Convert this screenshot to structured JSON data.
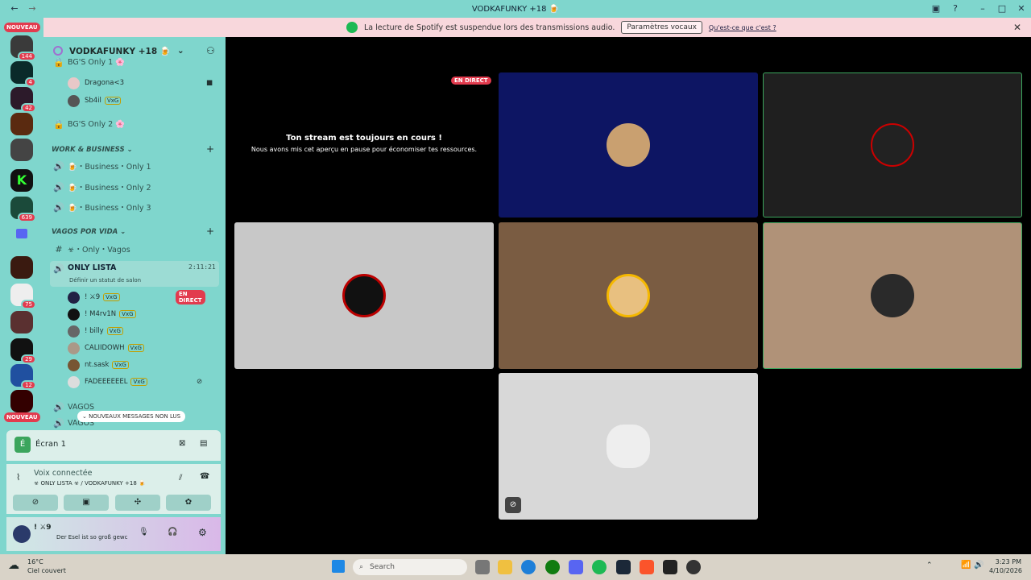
{
  "window": {
    "title": "VODKAFUNKY +18 🍺"
  },
  "banner": {
    "text": "La lecture de Spotify est suspendue lors des transmissions audio.",
    "button": "Paramètres vocaux",
    "link": "Qu'est-ce que c'est ?"
  },
  "rail": {
    "nouveau": "NOUVEAU",
    "badges": [
      "144",
      "4",
      "42",
      "639",
      "75",
      "29",
      "12"
    ]
  },
  "server": {
    "name": "VODKAFUNKY +18 🍺"
  },
  "channels": {
    "bg_only1": "BG'S Only 1 🌸",
    "bg_only2": "BG'S Only 2 🌸",
    "work_cat": "WORK & BUSINESS",
    "business": [
      "🍺・Business・Only 1",
      "🍺・Business・Only 2",
      "🍺・Business・Only 3"
    ],
    "vagos_cat": "VAGOS POR VIDA",
    "only_vagos": "☣・Only・Vagos",
    "only_lista": "ONLY LISTA",
    "only_lista_time": "2:11:21",
    "set_status": "Définir un statut de salon",
    "vagos1": "VAGOS",
    "vagos2": "VAGOS"
  },
  "users_top": [
    {
      "name": "Dragona<3",
      "tag": ""
    },
    {
      "name": "Sb4il",
      "tag": "VxG"
    }
  ],
  "users": [
    {
      "name": "! ⚔9",
      "tag": "VxG",
      "live": "EN DIRECT"
    },
    {
      "name": "! M4rv1N",
      "tag": "VxG",
      "live": ""
    },
    {
      "name": "! billy",
      "tag": "VxG",
      "live": ""
    },
    {
      "name": "CALIIDOWH",
      "tag": "VxG",
      "live": ""
    },
    {
      "name": "nt.sask",
      "tag": "VxG",
      "live": ""
    },
    {
      "name": "FADEEEEEEL",
      "tag": "VxG",
      "live": ""
    }
  ],
  "new_messages": "NOUVEAUX MESSAGES NON LUS",
  "screen": {
    "label": "Écran 1"
  },
  "voice": {
    "status": "Voix connectée",
    "channel": "☣ ONLY LISTA ☣ / VODKAFUNKY +18 🍺"
  },
  "me": {
    "name": "! ⚔9",
    "status": "Der Esel ist so groß gewc"
  },
  "stream": {
    "live": "EN DIRECT",
    "title": "Ton stream est toujours en cours !",
    "subtitle": "Nous avons mis cet aperçu en pause pour économiser tes ressources."
  },
  "taskbar": {
    "weather_temp": "16°C",
    "weather_desc": "Ciel couvert",
    "search": "Search",
    "time": "3:23 PM",
    "date": "4/10/2026"
  },
  "colors": {
    "accent": "#7fd6cd",
    "live": "#e23b4e",
    "spotify": "#1db954"
  }
}
